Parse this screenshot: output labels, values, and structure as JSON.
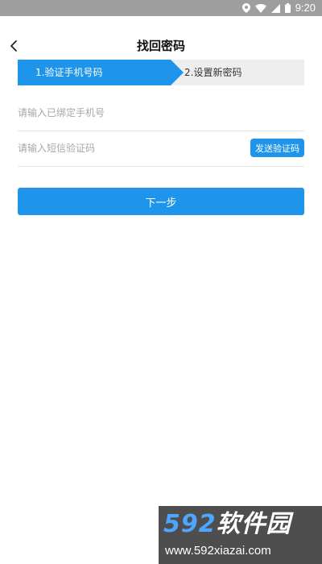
{
  "status_bar": {
    "time": "9:20",
    "icons": [
      "location-icon",
      "wifi-icon",
      "signal-icon",
      "battery-icon"
    ],
    "background": "#9e9e9e"
  },
  "header": {
    "title": "找回密码"
  },
  "steps": {
    "active_step": "1.验证手机号码",
    "next_step": "2.设置新密码",
    "active_color": "#1e95ea",
    "inactive_color": "#eeeeee"
  },
  "form": {
    "phone_placeholder": "请输入已绑定手机号",
    "phone_value": "",
    "code_placeholder": "请输入短信验证码",
    "code_value": "",
    "send_code_label": "发送验证码",
    "next_label": "下一步"
  },
  "watermark": {
    "logo_number": "592",
    "logo_text": "软件园",
    "url": "www.592xiazai.com"
  }
}
